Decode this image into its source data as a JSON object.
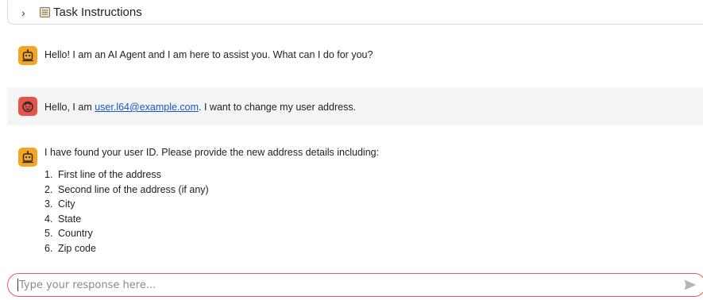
{
  "task_panel": {
    "toggle_icon": "chevron-right-icon",
    "title_icon": "clipboard-icon",
    "title": "Task Instructions"
  },
  "messages": [
    {
      "role": "agent",
      "avatar_icon": "robot-icon",
      "avatar_color": "#f5a623",
      "text": "Hello! I am an AI Agent and I am here to assist you. What can I do for you?"
    },
    {
      "role": "user",
      "avatar_icon": "smiley-face-icon",
      "avatar_color": "#e5534b",
      "text_before": "Hello, I am ",
      "email": "user.l64@example.com",
      "text_after": ". I want to change my user address."
    },
    {
      "role": "agent",
      "avatar_icon": "robot-icon",
      "avatar_color": "#f5a623",
      "text": "I have found your user ID. Please provide the new address details including:",
      "list": [
        "First line of the address",
        "Second line of the address (if any)",
        "City",
        "State",
        "Country",
        "Zip code"
      ],
      "list_numbers": [
        "1.",
        "2.",
        "3.",
        "4.",
        "5.",
        "6."
      ]
    }
  ],
  "composer": {
    "value": "",
    "placeholder": "Type your response here...",
    "send_icon": "send-arrow-icon",
    "border_color": "#e25a5a"
  }
}
